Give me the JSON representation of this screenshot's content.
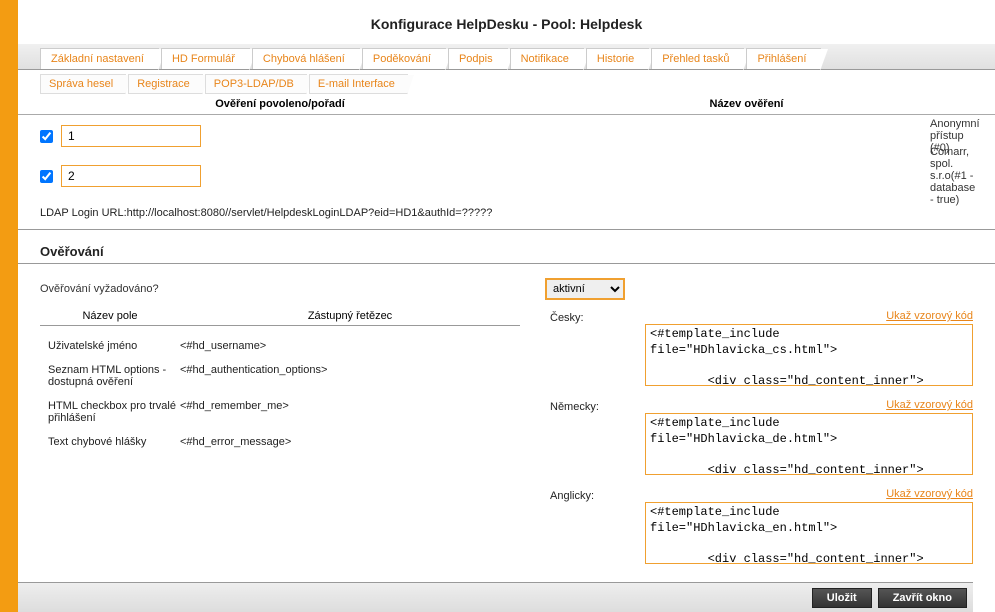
{
  "title": "Konfigurace HelpDesku - Pool: Helpdesk",
  "tabs": [
    "Základní nastavení",
    "HD Formulář",
    "Chybová hlášení",
    "Poděkování",
    "Podpis",
    "Notifikace",
    "Historie",
    "Přehled tasků",
    "Přihlášení"
  ],
  "subtabs": [
    "Správa hesel",
    "Registrace",
    "POP3-LDAP/DB",
    "E-mail Interface"
  ],
  "headers": {
    "order": "Ověření povoleno/pořadí",
    "name": "Název ověření"
  },
  "auth_rows": [
    {
      "checked": true,
      "order": "1",
      "name": "Anonymní přístup (#0)"
    },
    {
      "checked": true,
      "order": "2",
      "name": "Comarr, spol. s.r.o(#1 - database - true)"
    }
  ],
  "ldap_url": "LDAP Login URL:http://localhost:8080//servlet/HelpdeskLoginLDAP?eid=HD1&authId=?????",
  "section_title": "Ověřování",
  "req_label": "Ověřování vyžadováno?",
  "req_value": "aktivní",
  "field_hdr": {
    "c1": "Název pole",
    "c2": "Zástupný řetězec"
  },
  "fields": [
    {
      "c1": "Uživatelské jméno",
      "c2": "<#hd_username>"
    },
    {
      "c1": "Seznam HTML options - dostupná ověření",
      "c2": "<#hd_authentication_options>"
    },
    {
      "c1": "HTML checkbox pro trvalé přihlášení",
      "c2": "<#hd_remember_me>"
    },
    {
      "c1": "Text chybové hlášky",
      "c2": "<#hd_error_message>"
    }
  ],
  "tpl_link_text": "Ukaž vzorový kód",
  "templates": [
    {
      "label": "Česky:",
      "text": "<#template_include file=\"HDhlavicka_cs.html\">\n\n        <div class=\"hd_content_inner\">"
    },
    {
      "label": "Německy:",
      "text": "<#template_include file=\"HDhlavicka_de.html\">\n\n        <div class=\"hd_content_inner\">"
    },
    {
      "label": "Anglicky:",
      "text": "<#template_include file=\"HDhlavicka_en.html\">\n\n        <div class=\"hd_content_inner\">"
    }
  ],
  "buttons": {
    "save": "Uložit",
    "close": "Zavřít okno"
  }
}
